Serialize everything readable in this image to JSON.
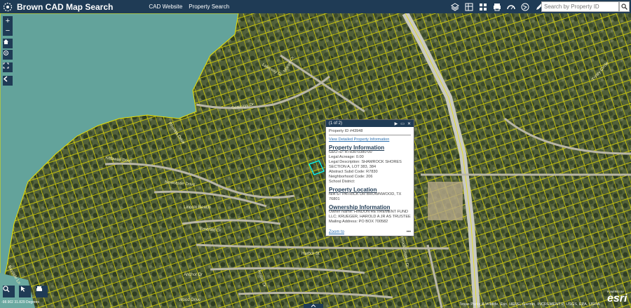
{
  "header": {
    "title": "Brown CAD Map Search",
    "links": [
      "CAD Website",
      "Property Search"
    ],
    "search_placeholder": "Search by Property ID"
  },
  "tools": [
    "layers-icon",
    "basemap-icon",
    "grid-icon",
    "print-icon",
    "measure-icon",
    "share-icon",
    "edit-icon"
  ],
  "map_controls": {
    "zoom_in": "+",
    "zoom_out": "−"
  },
  "streets": [
    "Kittaway Drive",
    "Rhonda Drive",
    "Newcastle Drive",
    "Lincoln Reach",
    "Emerald Dr",
    "Seaways Dr",
    "Manor Dr",
    "Harbor St",
    "Amber Dr",
    "Anchor Dr",
    "Shamrock Shores Dr",
    "Lakeway Dr",
    "Trinity Circle",
    "Bayside Ln",
    "Wood Drive"
  ],
  "popup": {
    "counter": "(1 of 2)",
    "property_id": "Property ID #43948",
    "view_link": "View Detailed Property Information",
    "sec_info": "Property  Information",
    "geo_id": "GEO ID: R7830-0380-00",
    "legal_acreage": "Legal Acreage: 0.00",
    "legal_desc": "Legal Description: SHAMROCK SHORES SECTION A, LOT 383, 384",
    "abstract": "Abstract Subd Code: R7830",
    "neighborhood": "Neighborhood Code: 206",
    "school": "School District:",
    "sec_location": "Property Location",
    "location": "N/A ST PATRICK DR BROWNWOOD, TX 76801",
    "sec_owner": "Ownership Information",
    "owner": "Owner Name: HINDON RETIREMENT FUND LLC; KRUEGER, HAROLD A JR AS TRUSTEE",
    "mailing": "Mailing Address: PO BOX 700582",
    "zoom": "Zoom to",
    "more": "•••"
  },
  "footer": {
    "scale": "-98.902 31.829 Degrees",
    "attribution": "Texas Parks & Wildlife, Esri, HERE, Garmin, INCREMENT P, USGS, EPA, USDA",
    "esri": "esri",
    "esri_sub": "POWERED BY"
  },
  "colors": {
    "header": "#1f3b55",
    "water": "#63a39b",
    "parcel": "#e8e000",
    "road": "#c9c9c0"
  }
}
